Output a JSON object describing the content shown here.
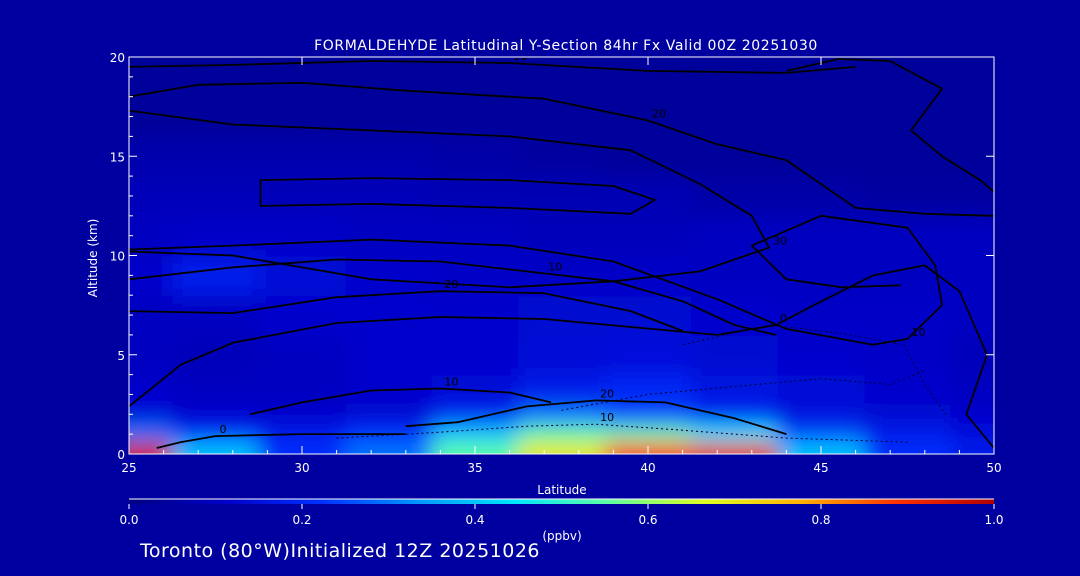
{
  "chart_data": {
    "type": "heatmap",
    "title": "FORMALDEHYDE Latitudinal Y-Section 84hr  Fx Valid 00Z 20251030",
    "xlabel": "Latitude",
    "ylabel": "Altitude (km)",
    "xlim": [
      25,
      50
    ],
    "ylim": [
      0,
      20
    ],
    "x_ticks": [
      25,
      30,
      35,
      40,
      45,
      50
    ],
    "y_ticks": [
      0,
      5,
      10,
      15,
      20
    ],
    "colorbar": {
      "label": "(ppbv)",
      "range": [
        0.0,
        1.0
      ],
      "ticks": [
        "0.0",
        "0.2",
        "0.4",
        "0.6",
        "0.8",
        "1.0"
      ],
      "colors": [
        "#000080",
        "#0000c8",
        "#0030ff",
        "#0096ff",
        "#00e6ff",
        "#60ffa0",
        "#e0ff20",
        "#ffb000",
        "#ff3000",
        "#b00000"
      ]
    },
    "heatmap_x": [
      25,
      27.5,
      30,
      32.5,
      35,
      37.5,
      40,
      42.5,
      45,
      47.5,
      50
    ],
    "heatmap_y": [
      0.25,
      1,
      2,
      3,
      5,
      7,
      9,
      11,
      13,
      15,
      17,
      19
    ],
    "heatmap_values": [
      [
        0.95,
        0.4,
        0.22,
        0.3,
        0.55,
        0.7,
        0.88,
        0.92,
        0.4,
        0.22,
        0.18
      ],
      [
        0.3,
        0.22,
        0.18,
        0.22,
        0.4,
        0.55,
        0.55,
        0.45,
        0.25,
        0.18,
        0.15
      ],
      [
        0.15,
        0.12,
        0.12,
        0.13,
        0.2,
        0.3,
        0.25,
        0.2,
        0.15,
        0.13,
        0.12
      ],
      [
        0.12,
        0.1,
        0.1,
        0.12,
        0.14,
        0.18,
        0.2,
        0.16,
        0.14,
        0.12,
        0.1
      ],
      [
        0.1,
        0.09,
        0.1,
        0.12,
        0.12,
        0.14,
        0.15,
        0.13,
        0.12,
        0.11,
        0.09
      ],
      [
        0.1,
        0.1,
        0.12,
        0.12,
        0.12,
        0.13,
        0.13,
        0.12,
        0.11,
        0.11,
        0.1
      ],
      [
        0.12,
        0.18,
        0.14,
        0.12,
        0.11,
        0.11,
        0.11,
        0.1,
        0.1,
        0.1,
        0.1
      ],
      [
        0.1,
        0.11,
        0.11,
        0.1,
        0.1,
        0.09,
        0.09,
        0.1,
        0.1,
        0.1,
        0.1
      ],
      [
        0.09,
        0.09,
        0.09,
        0.09,
        0.08,
        0.08,
        0.08,
        0.06,
        0.06,
        0.05,
        0.05
      ],
      [
        0.07,
        0.07,
        0.07,
        0.07,
        0.06,
        0.05,
        0.04,
        0.04,
        0.04,
        0.04,
        0.04
      ],
      [
        0.04,
        0.04,
        0.04,
        0.04,
        0.04,
        0.04,
        0.04,
        0.04,
        0.04,
        0.04,
        0.04
      ],
      [
        0.04,
        0.04,
        0.04,
        0.04,
        0.04,
        0.04,
        0.04,
        0.04,
        0.04,
        0.04,
        0.04
      ]
    ],
    "contours": [
      {
        "label": "10",
        "dotted": false,
        "points": [
          [
            25,
            19.5
          ],
          [
            28,
            19.6
          ],
          [
            32,
            19.8
          ],
          [
            36,
            19.7
          ],
          [
            40,
            19.3
          ],
          [
            44,
            19.2
          ],
          [
            46,
            19.5
          ]
        ]
      },
      {
        "label": "20",
        "dotted": false,
        "points": [
          [
            25,
            18
          ],
          [
            27,
            18.6
          ],
          [
            30,
            18.7
          ],
          [
            33,
            18.3
          ],
          [
            37,
            17.9
          ],
          [
            40,
            16.8
          ],
          [
            42,
            15.6
          ],
          [
            44,
            14.8
          ],
          [
            46,
            12.4
          ],
          [
            48,
            12.1
          ],
          [
            50,
            12
          ]
        ]
      },
      {
        "label": "30",
        "dotted": false,
        "points": [
          [
            25,
            17.3
          ],
          [
            28,
            16.6
          ],
          [
            32,
            16.3
          ],
          [
            36,
            16
          ],
          [
            39.5,
            15.3
          ],
          [
            41.5,
            13.6
          ],
          [
            43,
            12
          ],
          [
            43.5,
            10.4
          ],
          [
            41.5,
            9.2
          ],
          [
            39,
            8.7
          ],
          [
            36,
            8.4
          ],
          [
            32,
            8.8
          ],
          [
            28,
            10
          ],
          [
            25,
            10.2
          ]
        ]
      },
      {
        "label": "",
        "dotted": false,
        "points": [
          [
            28.8,
            13.8
          ],
          [
            32,
            13.9
          ],
          [
            36,
            13.8
          ],
          [
            39,
            13.5
          ],
          [
            40.2,
            12.8
          ],
          [
            39.5,
            12.1
          ],
          [
            36,
            12.4
          ],
          [
            32,
            12.6
          ],
          [
            28.8,
            12.5
          ],
          [
            28.8,
            13.8
          ]
        ]
      },
      {
        "label": "10",
        "dotted": false,
        "points": [
          [
            25,
            10.3
          ],
          [
            28,
            10.5
          ],
          [
            32,
            10.8
          ],
          [
            36,
            10.5
          ],
          [
            39,
            9.7
          ],
          [
            42,
            7.8
          ],
          [
            44,
            6.3
          ],
          [
            46.5,
            5.5
          ],
          [
            47.5,
            5.8
          ],
          [
            48.5,
            7.5
          ],
          [
            48.3,
            9.5
          ],
          [
            47.5,
            11.4
          ],
          [
            45,
            12
          ],
          [
            43,
            10.5
          ],
          [
            44,
            8.8
          ],
          [
            45.6,
            8.4
          ],
          [
            47.3,
            8.5
          ]
        ]
      },
      {
        "label": "10",
        "dotted": false,
        "points": [
          [
            25,
            8.8
          ],
          [
            28,
            9.4
          ],
          [
            31,
            9.8
          ],
          [
            34,
            9.7
          ],
          [
            37,
            9.1
          ],
          [
            39,
            8.7
          ],
          [
            41,
            7.7
          ],
          [
            42.5,
            6.5
          ],
          [
            43.7,
            6
          ]
        ]
      },
      {
        "label": "20",
        "dotted": false,
        "points": [
          [
            25,
            7.2
          ],
          [
            28,
            7.1
          ],
          [
            31,
            7.9
          ],
          [
            34,
            8.2
          ],
          [
            37,
            8.1
          ],
          [
            39.5,
            7.2
          ],
          [
            41,
            6.2
          ]
        ]
      },
      {
        "label": "0",
        "dotted": false,
        "points": [
          [
            25,
            2.4
          ],
          [
            26.5,
            4.5
          ],
          [
            28,
            5.6
          ],
          [
            31,
            6.6
          ],
          [
            34,
            6.9
          ],
          [
            37,
            6.8
          ],
          [
            39.5,
            6.4
          ],
          [
            42,
            6
          ],
          [
            43.7,
            6.5
          ],
          [
            44.8,
            7.5
          ],
          [
            46.5,
            9
          ],
          [
            48,
            9.5
          ],
          [
            49,
            8.2
          ],
          [
            49.8,
            5
          ],
          [
            49.2,
            2
          ],
          [
            50,
            0.3
          ]
        ]
      },
      {
        "label": "",
        "dotted": false,
        "points": [
          [
            44,
            19.3
          ],
          [
            45.5,
            19.9
          ],
          [
            47,
            19.8
          ],
          [
            48.5,
            18.4
          ],
          [
            47.6,
            16.3
          ],
          [
            48.5,
            15
          ],
          [
            49.6,
            13.8
          ],
          [
            50,
            13.2
          ]
        ]
      },
      {
        "label": "10",
        "dotted": false,
        "points": [
          [
            28.5,
            2
          ],
          [
            30,
            2.6
          ],
          [
            32,
            3.2
          ],
          [
            34,
            3.3
          ],
          [
            36,
            3.1
          ],
          [
            37.2,
            2.6
          ]
        ]
      },
      {
        "label": "20",
        "dotted": false,
        "points": [
          [
            33,
            1.4
          ],
          [
            34.5,
            1.6
          ],
          [
            36.5,
            2.4
          ],
          [
            38.5,
            2.7
          ],
          [
            40.5,
            2.6
          ],
          [
            42.5,
            1.8
          ],
          [
            44,
            1
          ]
        ]
      },
      {
        "label": "0",
        "dotted": false,
        "points": [
          [
            25.8,
            0.3
          ],
          [
            26.5,
            0.6
          ],
          [
            27.5,
            0.9
          ],
          [
            30,
            1
          ],
          [
            33,
            1
          ]
        ]
      },
      {
        "label": "10",
        "dotted": true,
        "points": [
          [
            31,
            0.8
          ],
          [
            34,
            1.1
          ],
          [
            36.5,
            1.4
          ],
          [
            38.5,
            1.5
          ],
          [
            41,
            1.2
          ],
          [
            44,
            0.8
          ],
          [
            47.5,
            0.6
          ]
        ]
      },
      {
        "label": "",
        "dotted": true,
        "points": [
          [
            37.5,
            2.2
          ],
          [
            40,
            3
          ],
          [
            42.5,
            3.4
          ],
          [
            45,
            3.8
          ],
          [
            47,
            3.5
          ],
          [
            48,
            4.2
          ]
        ]
      },
      {
        "label": "",
        "dotted": true,
        "points": [
          [
            41,
            5.5
          ],
          [
            43.5,
            6.5
          ],
          [
            45.5,
            6.1
          ],
          [
            47.4,
            5.5
          ],
          [
            48,
            3.5
          ],
          [
            48.6,
            2
          ]
        ]
      }
    ]
  },
  "footer": {
    "label": "Toronto (80°W)Initialized 12Z 20251026"
  }
}
